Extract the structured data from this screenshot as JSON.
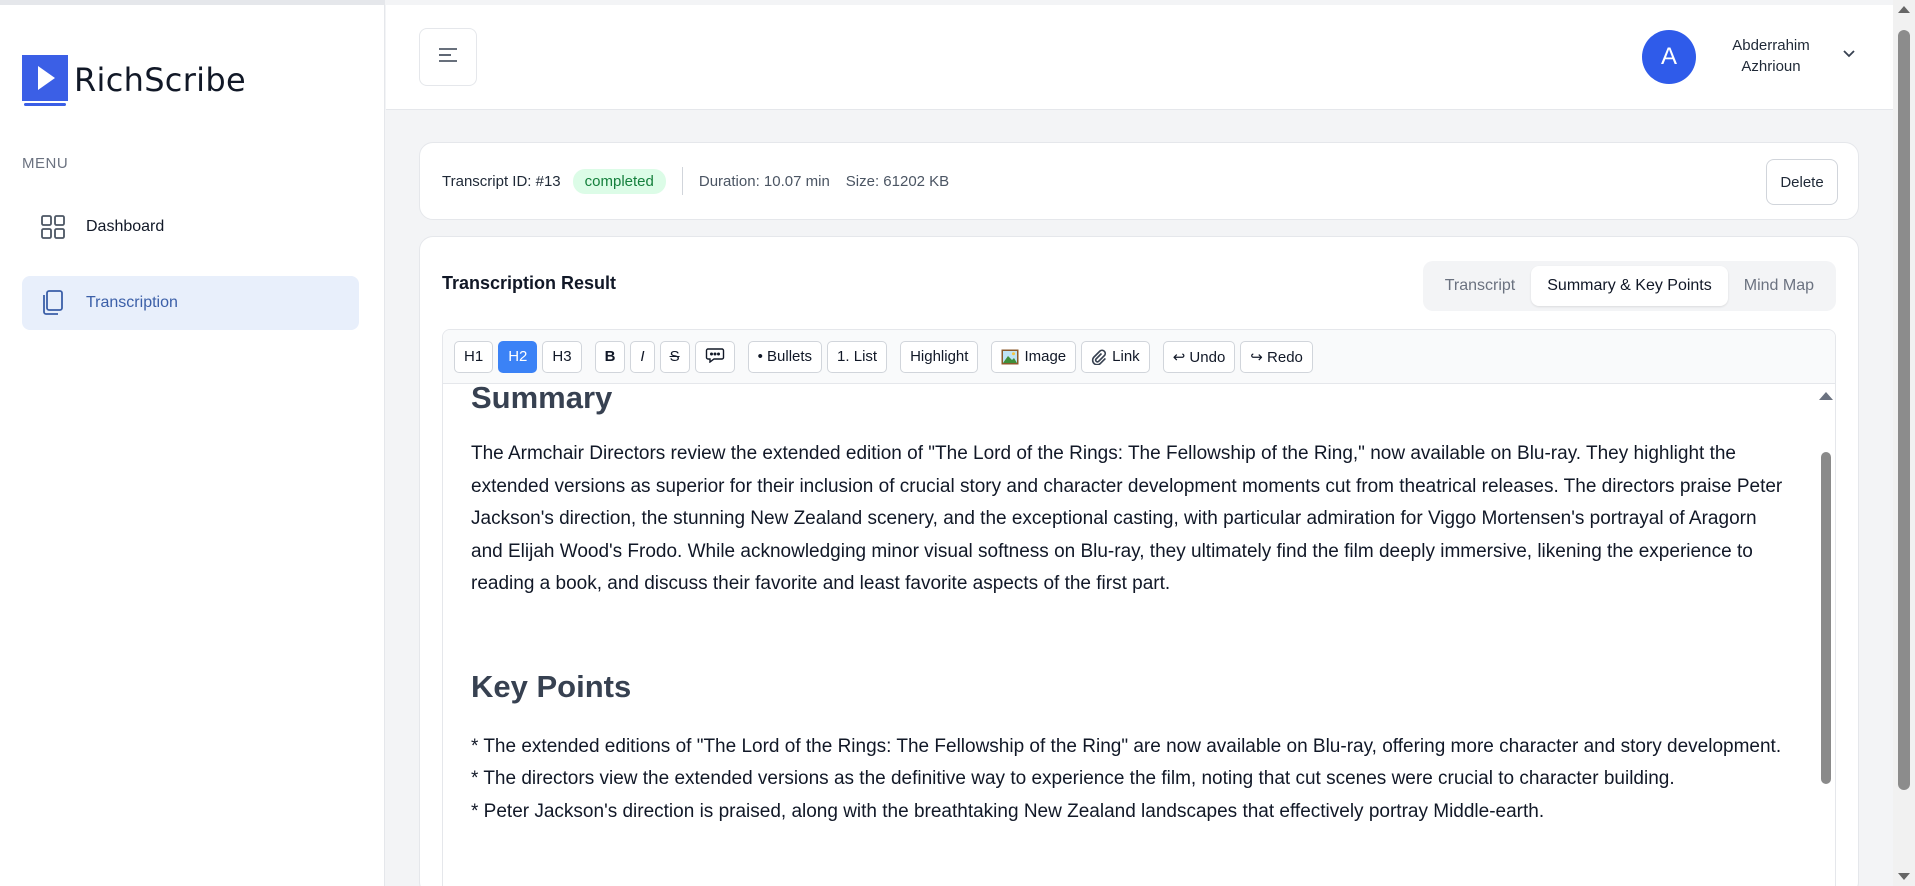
{
  "brand": {
    "name": "RichScribe",
    "accent": "#3b5fe6"
  },
  "sidebar": {
    "menu_label": "MENU",
    "items": [
      {
        "label": "Dashboard",
        "icon": "grid-icon",
        "active": false
      },
      {
        "label": "Transcription",
        "icon": "copy-icon",
        "active": true
      }
    ]
  },
  "header": {
    "avatar_initial": "A",
    "user_first": "Abderrahim",
    "user_last": "Azhrioun"
  },
  "info": {
    "transcript_id": "Transcript ID: #13",
    "status": "completed",
    "duration": "Duration: 10.07 min",
    "size": "Size: 61202 KB",
    "delete_label": "Delete"
  },
  "result": {
    "title": "Transcription Result",
    "tabs": [
      "Transcript",
      "Summary & Key Points",
      "Mind Map"
    ],
    "active_tab": "Summary & Key Points"
  },
  "toolbar": {
    "h1": "H1",
    "h2": "H2",
    "h3": "H3",
    "bold": "B",
    "italic": "I",
    "strike": "S",
    "bullets": "• Bullets",
    "list": "1. List",
    "highlight": "Highlight",
    "image": "Image",
    "link": "Link",
    "undo": "↩ Undo",
    "redo": "↪ Redo"
  },
  "content": {
    "summary_heading": "Summary",
    "summary_text": " The Armchair Directors review the extended edition of \"The Lord of the Rings: The Fellowship of the Ring,\" now available on Blu-ray. They highlight the extended versions as superior for their inclusion of crucial story and character development moments cut from theatrical releases. The directors praise Peter Jackson's direction, the stunning New Zealand scenery, and the exceptional casting, with particular admiration for Viggo Mortensen's portrayal of Aragorn and Elijah Wood's Frodo. While acknowledging minor visual softness on Blu-ray, they ultimately find the film deeply immersive, likening the experience to reading a book, and discuss their favorite and least favorite aspects of the first part.",
    "key_points_heading": "Key Points",
    "key_points": [
      "* The extended editions of \"The Lord of the Rings: The Fellowship of the Ring\" are now available on Blu-ray, offering more character and story development.",
      "* The directors view the extended versions as the definitive way to experience the film, noting that cut scenes were crucial to character building.",
      "* Peter Jackson's direction is praised, along with the breathtaking New Zealand landscapes that effectively portray Middle-earth."
    ]
  }
}
